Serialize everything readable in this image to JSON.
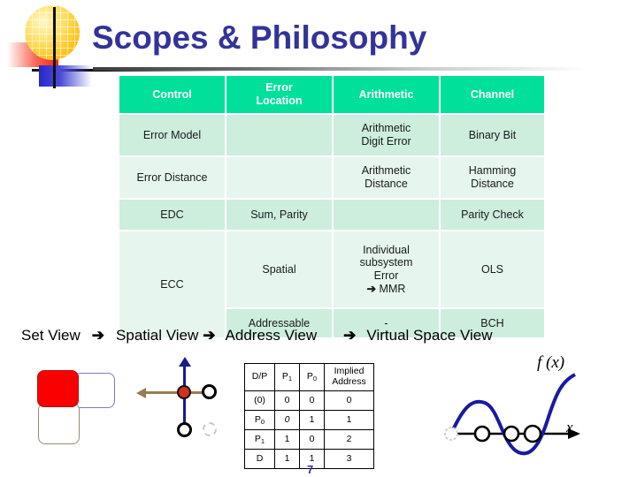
{
  "slide": {
    "title": "Scopes & Philosophy"
  },
  "logo": {
    "sphere": "yellow-grid-sphere",
    "red_block": "red-gradient-rectangle",
    "blue_block": "blue-gradient-rectangle",
    "axes": "black-cross-axes"
  },
  "table": {
    "headers": [
      "Control",
      "Error\nLocation",
      "Arithmetic",
      "Channel"
    ],
    "header_control": "Control",
    "header_error_location_line1": "Error",
    "header_error_location_line2": "Location",
    "header_arithmetic": "Arithmetic",
    "header_channel": "Channel",
    "rows": [
      {
        "control": "Error Model",
        "error_location": "",
        "arithmetic_line1": "Arithmetic",
        "arithmetic_line2": "Digit Error",
        "channel": "Binary Bit"
      },
      {
        "control": "Error Distance",
        "error_location": "",
        "arithmetic_line1": "Arithmetic",
        "arithmetic_line2": "Distance",
        "channel": "Hamming",
        "channel_line2": "Distance"
      },
      {
        "control": "EDC",
        "error_location": "Sum, Parity",
        "arithmetic": "",
        "channel": "Parity Check"
      },
      {
        "control": "ECC",
        "error_location": "Spatial",
        "arithmetic_line1": "Individual",
        "arithmetic_line2": "subsystem",
        "arithmetic_line3": "Error",
        "arithmetic_line4_arrow": "➔",
        "arithmetic_line4_text": "MMR",
        "channel": "OLS"
      },
      {
        "error_location": "Addressable",
        "arithmetic": "-",
        "channel": "BCH"
      }
    ]
  },
  "flow": {
    "step1": "Set View",
    "arrow1": "➔",
    "step2": "Spatial View",
    "arrow2": "➔",
    "step3": "Address View",
    "arrow3": "➔",
    "step4": "Virtual Space View"
  },
  "diagrams": {
    "set_view": {
      "name": "set-view-blocks",
      "selected_block_color": "#fa0000"
    },
    "spatial_view": {
      "name": "spatial-view-cross",
      "vertical_axis_color": "#1a1a8c",
      "horizontal_axis_color": "#9a7b4f",
      "center_node_color": "#d03020"
    },
    "virtual_space_view": {
      "name": "function-curve",
      "curve_color": "#1a1aa0",
      "fx_label": "f (x)",
      "x_label": "x"
    }
  },
  "mini_table": {
    "headers": {
      "dp": "D/P",
      "p1": "P",
      "p1_sub": "1",
      "p0": "P",
      "p0_sub": "0",
      "implied_line1": "Implied",
      "implied_line2": "Address"
    },
    "rows": [
      {
        "dp": "(0)",
        "dp_sub": "",
        "p1": "0",
        "p0": "0",
        "implied": "0"
      },
      {
        "dp": "P",
        "dp_sub": "0",
        "p1": "0",
        "p0": "1",
        "implied": "1"
      },
      {
        "dp": "P",
        "dp_sub": "1",
        "p1": "1",
        "p0": "0",
        "implied": "2"
      },
      {
        "dp": "D",
        "dp_sub": "",
        "p1": "1",
        "p0": "1",
        "implied": "3"
      }
    ]
  },
  "page_number": "7",
  "colors": {
    "title": "#333399",
    "header_cell": "#00e09b",
    "row_dark": "#cdeedd",
    "row_light": "#e6f6ee"
  }
}
